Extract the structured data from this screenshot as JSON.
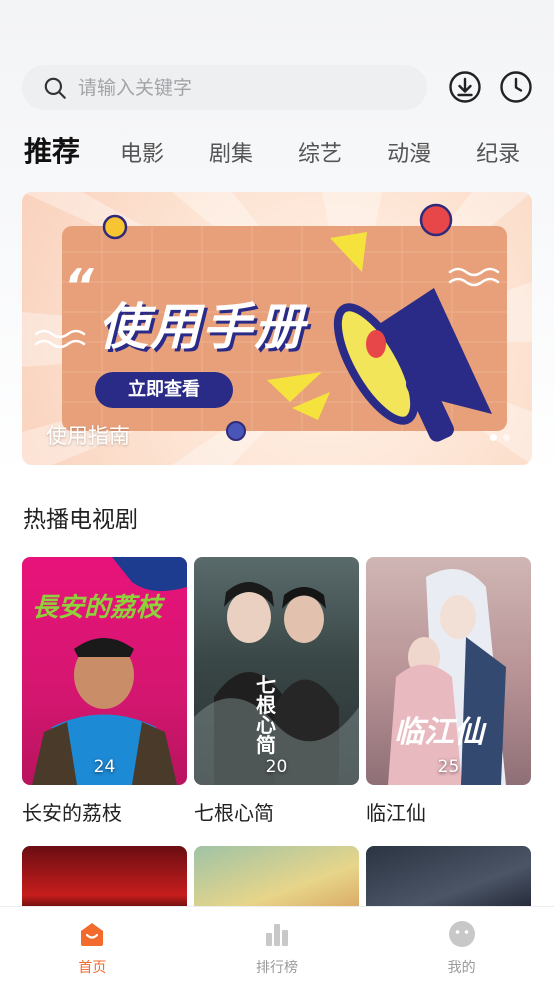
{
  "search": {
    "placeholder": "请输入关键字"
  },
  "header_icons": {
    "download": "download-icon",
    "history": "clock-icon"
  },
  "tabs": [
    {
      "label": "推荐",
      "active": true
    },
    {
      "label": "电影"
    },
    {
      "label": "剧集"
    },
    {
      "label": "综艺"
    },
    {
      "label": "动漫"
    },
    {
      "label": "纪录"
    }
  ],
  "banner": {
    "headline": "使用手册",
    "button_label": "立即查看",
    "caption": "使用指南",
    "slide_index": 1,
    "slide_count": 2
  },
  "section": {
    "title": "热播电视剧"
  },
  "dramas": [
    {
      "title": "长安的荔枝",
      "count": "24",
      "poster_text": "長安的荔枝",
      "accent": "#e31a7a"
    },
    {
      "title": "七根心简",
      "count": "20",
      "poster_text": "七根心简",
      "accent": "#3b4a4a"
    },
    {
      "title": "临江仙",
      "count": "25",
      "poster_text": "临江仙",
      "accent": "#c9a6a8"
    }
  ],
  "bottom_nav": [
    {
      "label": "首页",
      "icon": "home-icon",
      "active": true
    },
    {
      "label": "排行榜",
      "icon": "chart-bars-icon"
    },
    {
      "label": "我的",
      "icon": "profile-face-icon"
    }
  ],
  "colors": {
    "accent": "#f26b2c",
    "search_bg": "#eeeff1"
  }
}
